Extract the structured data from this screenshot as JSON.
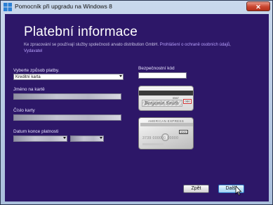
{
  "window": {
    "title": "Pomocník při upgradu na Windows 8",
    "close_label": "✕"
  },
  "page": {
    "heading": "Platební informace",
    "privacy_text": "Ke zpracování se používají služby společnosti arvato distribution GmbH. ",
    "privacy_link": "Prohlášení o ochraně osobních údajů",
    "privacy_separator": ", ",
    "terms_link": "Vydavatel"
  },
  "form": {
    "payment_method_label": "Vyberte způsob platby.",
    "payment_method_value": "Kreditní karta",
    "name_label": "Jméno na kartě",
    "name_value": "",
    "number_label": "Číslo karty",
    "number_value": "",
    "expiry_label": "Datum konce platnosti",
    "expiry_month_value": "",
    "expiry_year_value": "",
    "security_code_label": "Bezpečnostní kód",
    "security_code_value": ""
  },
  "cards": {
    "back_signature": "Benjamin Smith",
    "back_number": "0567",
    "back_cvv": "000",
    "front_brand": "AMERICAN EXPRESS",
    "front_cvv": "0000",
    "front_number": "3739  000000  00000"
  },
  "buttons": {
    "back_label": "Zpět",
    "next_label": "Další"
  }
}
